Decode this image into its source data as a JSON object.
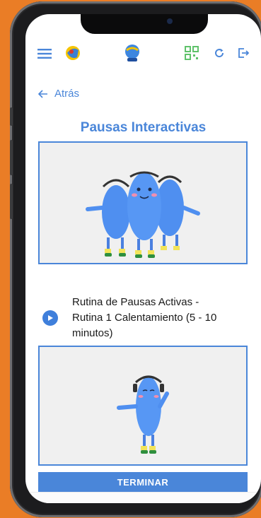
{
  "header": {
    "menu_icon": "hamburger-menu-icon",
    "app_logo": "app-logo",
    "center_logo": "center-logo",
    "qr_icon": "qr-code-icon",
    "refresh_icon": "refresh-icon",
    "logout_icon": "logout-icon"
  },
  "back": {
    "label": "Atrás"
  },
  "page": {
    "title": "Pausas Interactivas"
  },
  "routines": [
    {
      "title": "Rutina de Pausas Activas - Rutina 1 Calentamiento (5 - 10 minutos)"
    }
  ],
  "actions": {
    "finish_label": "TERMINAR"
  },
  "navbar": {
    "items": [
      "recent-apps-icon",
      "home-icon",
      "back-icon"
    ]
  },
  "colors": {
    "accent": "#4a86d9",
    "background": "#ea7d26",
    "character": "#4f8ff0"
  }
}
